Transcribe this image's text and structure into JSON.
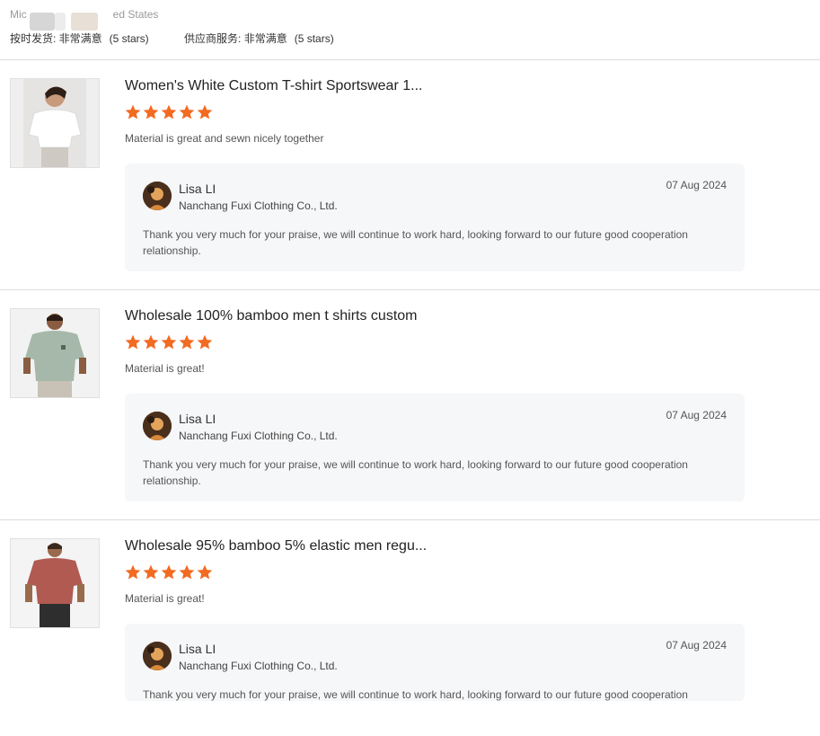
{
  "header": {
    "reviewer_prefix": "Mic",
    "reviewer_suffix": "ed States",
    "ratings": [
      {
        "label": "按时发货: 非常满意",
        "stars": "(5 stars)"
      },
      {
        "label": "供应商服务: 非常满意",
        "stars": "(5 stars)"
      }
    ]
  },
  "colors": {
    "star": "#f36a21",
    "reply_bg": "#f6f7f9",
    "divider": "#dcdcdc"
  },
  "reviews": [
    {
      "product_title": "Women's White Custom T-shirt Sportswear 1...",
      "rating": 5,
      "comment": "Material is great and sewn nicely together",
      "reply": {
        "name": "Lisa LI",
        "company": "Nanchang Fuxi Clothing Co., Ltd.",
        "date": "07 Aug 2024",
        "message": "Thank you very much for your praise, we will continue to work hard, looking forward to our future good cooperation relationship."
      }
    },
    {
      "product_title": "Wholesale 100% bamboo men t shirts custom",
      "rating": 5,
      "comment": "Material is great!",
      "reply": {
        "name": "Lisa LI",
        "company": "Nanchang Fuxi Clothing Co., Ltd.",
        "date": "07 Aug 2024",
        "message": "Thank you very much for your praise, we will continue to work hard, looking forward to our future good cooperation relationship."
      }
    },
    {
      "product_title": "Wholesale 95% bamboo 5% elastic men regu...",
      "rating": 5,
      "comment": "Material is great!",
      "reply": {
        "name": "Lisa LI",
        "company": "Nanchang Fuxi Clothing Co., Ltd.",
        "date": "07 Aug 2024",
        "message": "Thank you very much for your praise, we will continue to work hard, looking forward to our future good cooperation"
      }
    }
  ]
}
